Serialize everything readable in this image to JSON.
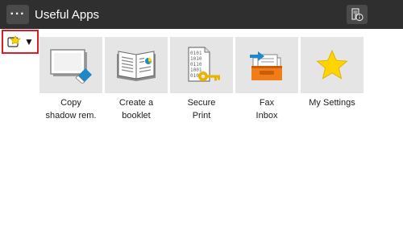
{
  "header": {
    "menu_glyph": "···",
    "title": "Useful Apps",
    "status_icon": "job-status-info-icon"
  },
  "selector": {
    "icon": "app-selector-icon",
    "caret": "▼",
    "highlight_color": "#e01b24"
  },
  "apps": [
    {
      "line1": "Copy",
      "line2": "shadow rem.",
      "icon": "copy-shadow-removal-icon"
    },
    {
      "line1": "Create a",
      "line2": "booklet",
      "icon": "booklet-icon"
    },
    {
      "line1": "Secure",
      "line2": "Print",
      "icon": "secure-print-icon"
    },
    {
      "line1": "Fax",
      "line2": "Inbox",
      "icon": "fax-inbox-icon"
    },
    {
      "line1": "My Settings",
      "line2": "",
      "icon": "star-icon"
    }
  ],
  "colors": {
    "header_bg": "#2f2f2f",
    "tile_bg": "#e5e5e5",
    "accent_blue": "#1e88c8",
    "accent_orange": "#f07d18",
    "star_yellow": "#ffd400",
    "key_gold": "#e8b400"
  }
}
